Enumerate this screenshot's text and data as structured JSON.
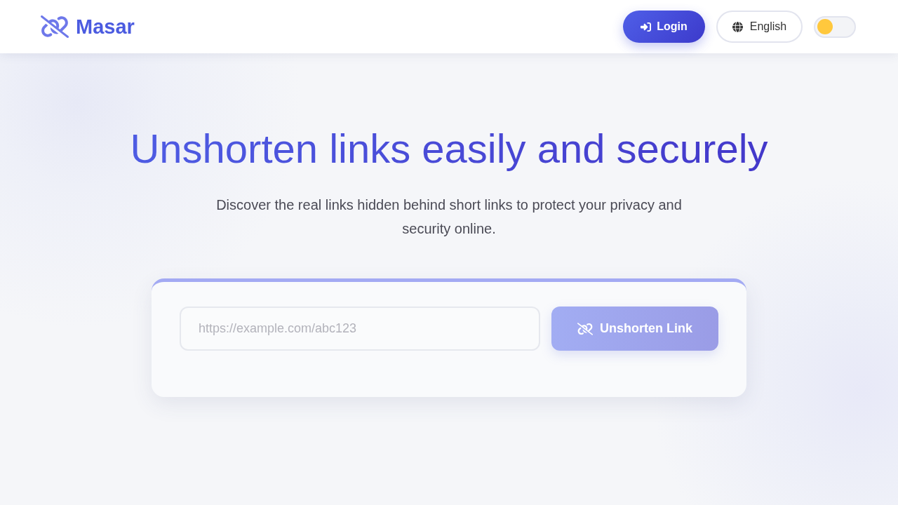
{
  "header": {
    "logo": "Masar",
    "login_button": "Login",
    "language_button": "English",
    "theme_toggle": {
      "on": false
    }
  },
  "hero": {
    "title": "Unshorten links easily and securely",
    "subtitle": "Discover the real links hidden behind short links to protect your privacy and security online."
  },
  "form": {
    "url_field": {
      "placeholder": "https://example.com/abc123"
    },
    "submit_button": {
      "label": "Unshorten Link",
      "disabled": true
    }
  }
}
